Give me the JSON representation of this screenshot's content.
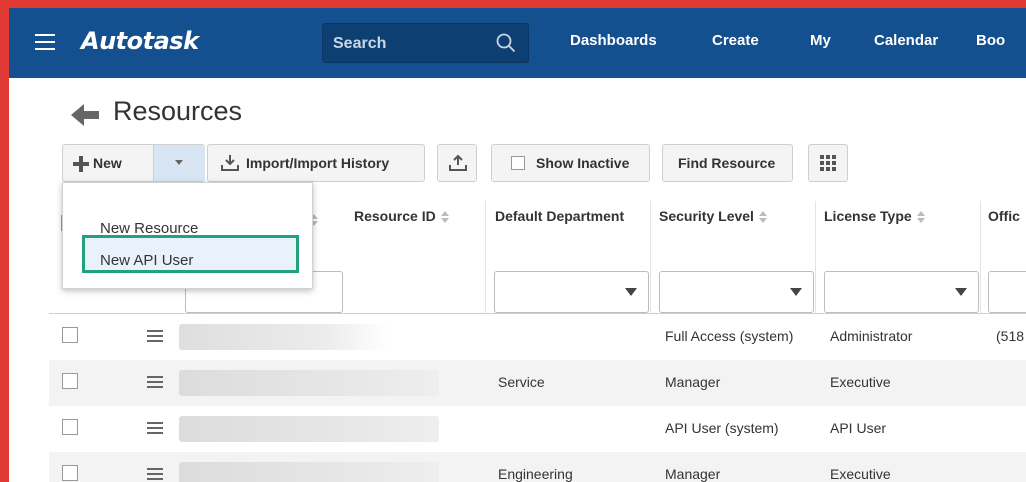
{
  "topbar": {
    "brand": "Autotask",
    "search_placeholder": "Search",
    "nav": [
      "Dashboards",
      "Create",
      "My",
      "Calendar",
      "Boo"
    ],
    "bg": "#14508f"
  },
  "page": {
    "title": "Resources"
  },
  "toolbar": {
    "new_label": "New",
    "import_label": "Import/Import History",
    "show_inactive_label": "Show Inactive",
    "find_resource_label": "Find Resource"
  },
  "new_menu": {
    "items": [
      "New Resource",
      "New API User"
    ],
    "highlight_color": "#23a07d"
  },
  "table": {
    "columns": [
      "Resource ID",
      "Default Department",
      "Security Level",
      "License Type",
      "Offic"
    ],
    "rows": [
      {
        "department": "",
        "security": "Full Access (system)",
        "license": "Administrator",
        "office": "(518"
      },
      {
        "department": "Service",
        "security": "Manager",
        "license": "Executive",
        "office": ""
      },
      {
        "department": "",
        "security": "API User (system)",
        "license": "API User",
        "office": ""
      },
      {
        "department": "Engineering",
        "security": "Manager",
        "license": "Executive",
        "office": ""
      }
    ]
  }
}
